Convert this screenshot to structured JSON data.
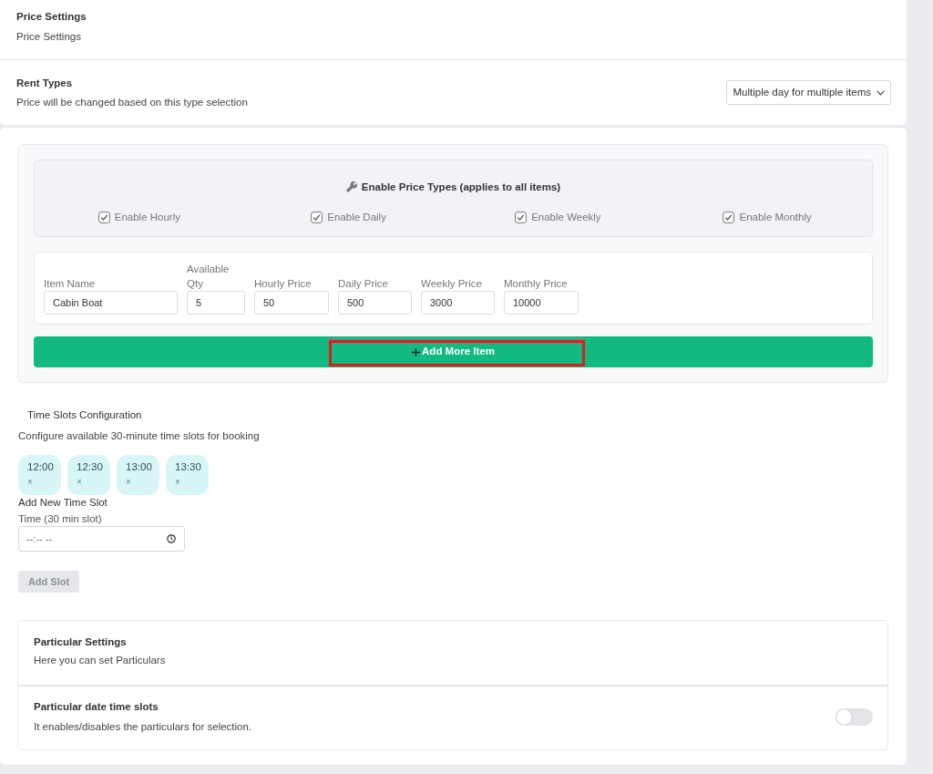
{
  "price_settings": {
    "title": "Price Settings",
    "subtitle": "Price Settings"
  },
  "rent_types": {
    "title": "Rent Types",
    "description": "Price will be changed based on this type selection",
    "select": {
      "value": "Multiple day for multiple items"
    }
  },
  "price_types": {
    "title": "Enable Price Types (applies to all items)",
    "options": [
      {
        "label": "Enable Hourly",
        "checked": true
      },
      {
        "label": "Enable Daily",
        "checked": true
      },
      {
        "label": "Enable Weekly",
        "checked": true
      },
      {
        "label": "Enable Monthly",
        "checked": true
      }
    ]
  },
  "items": [
    {
      "fields": [
        {
          "label": "Item Name",
          "value": "Cabin Boat"
        },
        {
          "label": "Available Qty",
          "value": "5"
        },
        {
          "label": "Hourly Price",
          "value": "50"
        },
        {
          "label": "Daily Price",
          "value": "500"
        },
        {
          "label": "Weekly Price",
          "value": "3000"
        },
        {
          "label": "Monthly Price",
          "value": "10000"
        }
      ]
    }
  ],
  "add_item_button": {
    "label": "Add More Item",
    "highlighted": true
  },
  "time_slots": {
    "title": "Time Slots Configuration",
    "description": "Configure available 30-minute time slots for booking",
    "slots": [
      {
        "time": "12:00",
        "remove": "×"
      },
      {
        "time": "12:30",
        "remove": "×"
      },
      {
        "time": "13:00",
        "remove": "×"
      },
      {
        "time": "13:30",
        "remove": "×"
      }
    ],
    "add_title": "Add New Time Slot",
    "time_label": "Time (30 min slot)",
    "time_input": {
      "placeholder": "--:-- --"
    },
    "add_button": {
      "label": "Add Slot",
      "disabled": true
    }
  },
  "particular_settings": {
    "title": "Particular Settings",
    "description": "Here you can set Particulars",
    "rows": [
      {
        "title": "Particular date time slots",
        "description": "It enables/disables the particulars for selection.",
        "on": false
      }
    ]
  }
}
